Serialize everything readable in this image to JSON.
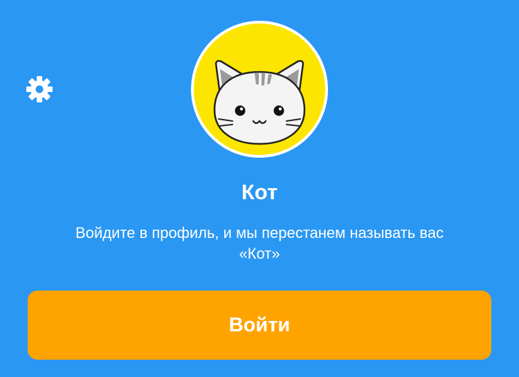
{
  "settings": {
    "icon": "gear-icon"
  },
  "avatar": {
    "icon": "cat-icon"
  },
  "profile": {
    "name": "Кот",
    "hint": "Войдите в профиль, и мы перестанем называть вас «Кот»"
  },
  "login_button": {
    "label": "Войти"
  },
  "colors": {
    "background": "#2a97f2",
    "avatar_background": "#fce500",
    "button": "#ffa300",
    "text": "#ffffff"
  }
}
